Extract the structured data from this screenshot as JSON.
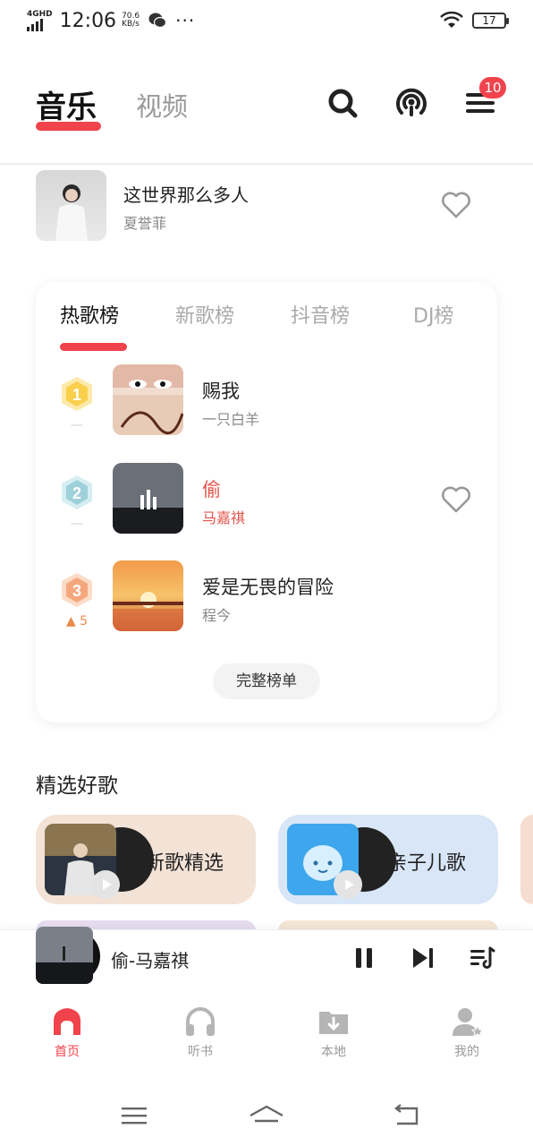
{
  "statusbar": {
    "network": "4GHD",
    "time": "12:06",
    "speed_value": "70.6",
    "speed_unit": "KB/s",
    "dots": "···",
    "battery": "17"
  },
  "header": {
    "tab_music": "音乐",
    "tab_video": "视频",
    "menu_badge": "10"
  },
  "now_playing_card": {
    "title": "这世界那么多人",
    "artist": "夏誉菲"
  },
  "chart": {
    "tabs": [
      "热歌榜",
      "新歌榜",
      "抖音榜",
      "DJ榜"
    ],
    "items": [
      {
        "rank": "1",
        "trend": "—",
        "title": "赐我",
        "artist": "一只白羊",
        "playing": false
      },
      {
        "rank": "2",
        "trend": "—",
        "title": "偷",
        "artist": "马嘉祺",
        "playing": true
      },
      {
        "rank": "3",
        "trend": "▲ 5",
        "title": "爱是无畏的冒险",
        "artist": "程今",
        "playing": false
      }
    ],
    "full_list_label": "完整榜单"
  },
  "picks": {
    "section_title": "精选好歌",
    "cards": [
      {
        "label": "新歌精选"
      },
      {
        "label": "亲子儿歌"
      }
    ]
  },
  "mini_player": {
    "title": "偷-马嘉祺"
  },
  "bottom_nav": {
    "items": [
      {
        "label": "首页",
        "active": true
      },
      {
        "label": "听书",
        "active": false
      },
      {
        "label": "本地",
        "active": false
      },
      {
        "label": "我的",
        "active": false
      }
    ]
  },
  "colors": {
    "accent": "#f0434c",
    "playing_text": "#e5534b"
  }
}
